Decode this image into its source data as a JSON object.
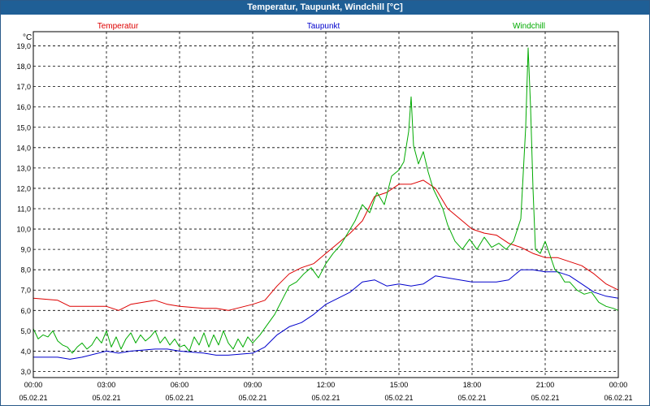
{
  "window": {
    "title": "Temperatur, Taupunkt, Windchill [°C]"
  },
  "colors": {
    "titlebar": "#1f5f96",
    "temperatur": "#dd0000",
    "taupunkt": "#0000cc",
    "windchill": "#00aa00",
    "grid": "#000000"
  },
  "chart_data": {
    "type": "line",
    "title": "Temperatur, Taupunkt, Windchill [°C]",
    "ylabel": "°C",
    "xlabel": "",
    "xlim": [
      0,
      24
    ],
    "ylim": [
      2.7,
      19.7
    ],
    "grid": true,
    "legend_position": "top",
    "y_ticks": [
      "3,0",
      "4,0",
      "5,0",
      "6,0",
      "7,0",
      "8,0",
      "9,0",
      "10,0",
      "11,0",
      "12,0",
      "13,0",
      "14,0",
      "15,0",
      "16,0",
      "17,0",
      "18,0",
      "19,0"
    ],
    "x_ticks": [
      {
        "time": "00:00",
        "date": "05.02.21"
      },
      {
        "time": "03:00",
        "date": "05.02.21"
      },
      {
        "time": "06:00",
        "date": "05.02.21"
      },
      {
        "time": "09:00",
        "date": "05.02.21"
      },
      {
        "time": "12:00",
        "date": "05.02.21"
      },
      {
        "time": "15:00",
        "date": "05.02.21"
      },
      {
        "time": "18:00",
        "date": "05.02.21"
      },
      {
        "time": "21:00",
        "date": "05.02.21"
      },
      {
        "time": "00:00",
        "date": "06.02.21"
      }
    ],
    "x_unit": "hours since 05.02.21 00:00",
    "series": [
      {
        "name": "Temperatur",
        "color": "#dd0000",
        "x": [
          0,
          1,
          1.5,
          2,
          3,
          3.5,
          4,
          5,
          5.5,
          6,
          7,
          7.5,
          8,
          9,
          9.5,
          10,
          10.5,
          11,
          11.5,
          12,
          12.5,
          13,
          13.5,
          14,
          14.5,
          15,
          15.5,
          16,
          16.5,
          17,
          17.5,
          18,
          18.5,
          19,
          19.5,
          20,
          20.5,
          21,
          21.5,
          22,
          22.5,
          23,
          23.5,
          24
        ],
        "values": [
          6.6,
          6.5,
          6.2,
          6.2,
          6.2,
          6.0,
          6.3,
          6.5,
          6.3,
          6.2,
          6.1,
          6.1,
          6.0,
          6.3,
          6.5,
          7.2,
          7.8,
          8.1,
          8.3,
          8.8,
          9.3,
          9.8,
          10.4,
          11.6,
          11.8,
          12.2,
          12.2,
          12.4,
          12.0,
          11.0,
          10.5,
          10.0,
          9.8,
          9.7,
          9.3,
          9.1,
          8.8,
          8.6,
          8.6,
          8.4,
          8.2,
          7.8,
          7.3,
          7.0
        ]
      },
      {
        "name": "Taupunkt",
        "color": "#0000cc",
        "x": [
          0,
          1,
          1.5,
          2,
          3,
          3.5,
          4,
          5,
          5.5,
          6,
          7,
          7.5,
          8,
          9,
          9.5,
          10,
          10.5,
          11,
          11.5,
          12,
          12.5,
          13,
          13.5,
          14,
          14.5,
          15,
          15.5,
          16,
          16.5,
          17,
          17.5,
          18,
          18.5,
          19,
          19.5,
          20,
          20.5,
          21,
          21.5,
          22,
          22.5,
          23,
          23.5,
          24
        ],
        "values": [
          3.7,
          3.7,
          3.6,
          3.7,
          4.0,
          3.9,
          4.0,
          4.1,
          4.1,
          4.0,
          3.9,
          3.8,
          3.8,
          3.9,
          4.2,
          4.8,
          5.2,
          5.4,
          5.8,
          6.3,
          6.6,
          6.9,
          7.4,
          7.5,
          7.2,
          7.3,
          7.2,
          7.3,
          7.7,
          7.6,
          7.5,
          7.4,
          7.4,
          7.4,
          7.5,
          8.0,
          8.0,
          7.9,
          7.9,
          7.7,
          7.3,
          6.9,
          6.7,
          6.6
        ]
      },
      {
        "name": "Windchill",
        "color": "#00aa00",
        "x": [
          0,
          0.2,
          0.4,
          0.6,
          0.8,
          1,
          1.2,
          1.4,
          1.6,
          1.8,
          2,
          2.2,
          2.4,
          2.6,
          2.8,
          3,
          3.2,
          3.4,
          3.6,
          3.8,
          4,
          4.2,
          4.4,
          4.6,
          4.8,
          5,
          5.2,
          5.4,
          5.6,
          5.8,
          6,
          6.2,
          6.4,
          6.6,
          6.8,
          7,
          7.2,
          7.4,
          7.6,
          7.8,
          8,
          8.2,
          8.4,
          8.6,
          8.8,
          9,
          9.3,
          9.6,
          9.9,
          10.2,
          10.5,
          10.8,
          11.1,
          11.4,
          11.7,
          12,
          12.3,
          12.6,
          12.9,
          13.2,
          13.5,
          13.8,
          14.1,
          14.4,
          14.7,
          15,
          15.2,
          15.4,
          15.5,
          15.6,
          15.8,
          16,
          16.2,
          16.4,
          16.6,
          16.8,
          17,
          17.3,
          17.6,
          17.9,
          18.2,
          18.5,
          18.8,
          19.1,
          19.4,
          19.7,
          20,
          20.2,
          20.3,
          20.4,
          20.5,
          20.6,
          20.8,
          21,
          21.2,
          21.4,
          21.6,
          21.8,
          22,
          22.3,
          22.6,
          22.9,
          23.2,
          23.5,
          23.8,
          24
        ],
        "values": [
          5.1,
          4.6,
          4.8,
          4.7,
          5.0,
          4.5,
          4.3,
          4.2,
          3.9,
          4.2,
          4.4,
          4.1,
          4.3,
          4.7,
          4.4,
          5.0,
          4.2,
          4.7,
          4.1,
          4.6,
          4.9,
          4.4,
          4.8,
          4.5,
          4.7,
          5.0,
          4.4,
          4.7,
          4.3,
          4.6,
          4.2,
          4.3,
          4.0,
          4.7,
          4.3,
          4.9,
          4.2,
          4.8,
          4.3,
          5.0,
          4.4,
          4.1,
          4.6,
          4.2,
          4.7,
          4.4,
          4.8,
          5.3,
          5.8,
          6.5,
          7.2,
          7.4,
          7.8,
          8.1,
          7.6,
          8.3,
          8.8,
          9.2,
          9.8,
          10.4,
          11.2,
          10.8,
          11.8,
          11.2,
          12.6,
          12.9,
          13.3,
          14.8,
          16.5,
          14.1,
          13.2,
          13.8,
          12.8,
          12.0,
          11.5,
          11.0,
          10.2,
          9.4,
          9.0,
          9.5,
          9.0,
          9.6,
          9.1,
          9.3,
          9.0,
          9.4,
          10.5,
          15.0,
          18.9,
          16.0,
          12.0,
          9.0,
          8.8,
          9.4,
          8.7,
          8.0,
          7.8,
          7.4,
          7.4,
          7.0,
          6.8,
          6.9,
          6.4,
          6.2,
          6.1,
          6.0
        ]
      }
    ]
  }
}
